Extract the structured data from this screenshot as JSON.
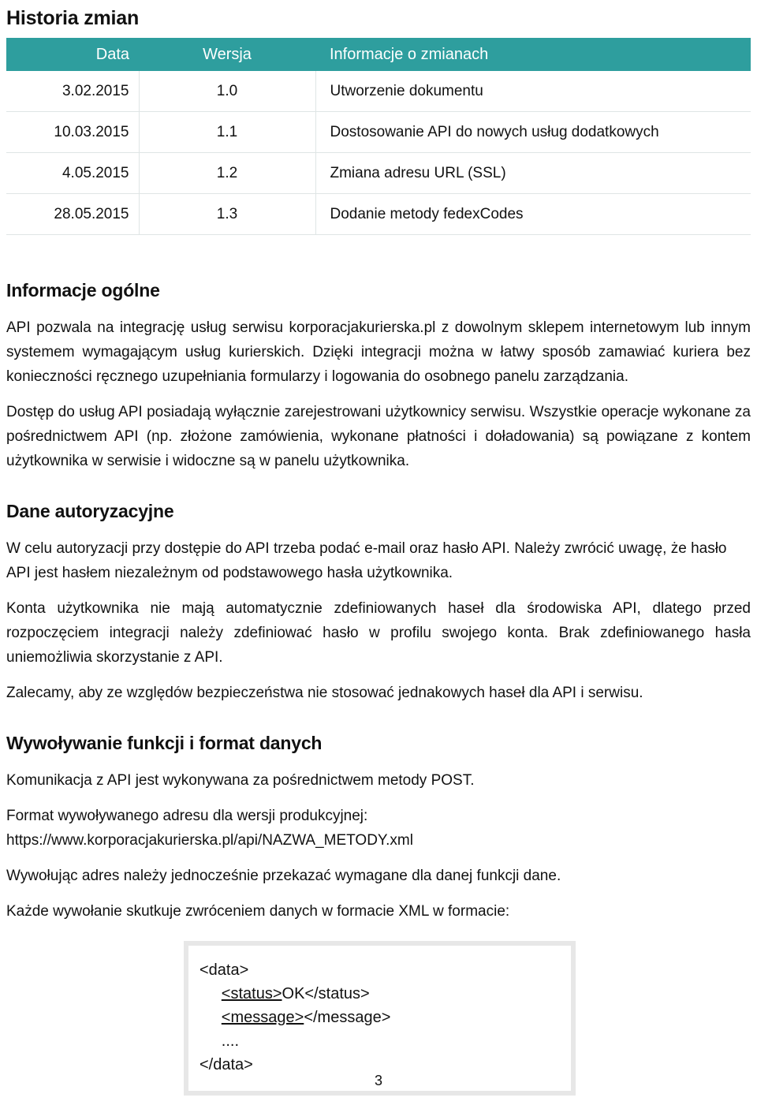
{
  "document": {
    "page_number": "3"
  },
  "history": {
    "heading": "Historia zmian",
    "columns": [
      "Data",
      "Wersja",
      "Informacje o zmianach"
    ],
    "header_bg": "#2e9e9e",
    "rows": [
      {
        "date": "3.02.2015",
        "version": "1.0",
        "info": "Utworzenie dokumentu"
      },
      {
        "date": "10.03.2015",
        "version": "1.1",
        "info": "Dostosowanie API do nowych usług dodatkowych"
      },
      {
        "date": "4.05.2015",
        "version": "1.2",
        "info": "Zmiana adresu URL (SSL)"
      },
      {
        "date": "28.05.2015",
        "version": "1.3",
        "info": "Dodanie metody fedexCodes"
      }
    ]
  },
  "general": {
    "heading": "Informacje ogólne",
    "paragraphs": [
      "API pozwala na integrację usług serwisu korporacjakurierska.pl z dowolnym sklepem internetowym lub innym systemem wymagającym usług kurierskich. Dzięki integracji można w łatwy sposób zamawiać kuriera bez konieczności ręcznego uzupełniania formularzy i logowania do osobnego panelu zarządzania.",
      "Dostęp do usług API posiadają wyłącznie zarejestrowani użytkownicy serwisu. Wszystkie operacje wykonane za pośrednictwem API (np. złożone zamówienia, wykonane płatności i doładowania) są powiązane z kontem użytkownika w serwisie i widoczne są w panelu użytkownika."
    ]
  },
  "auth": {
    "heading": "Dane autoryzacyjne",
    "paragraphs": [
      "W celu autoryzacji przy dostępie do API trzeba podać e-mail oraz hasło API. Należy zwrócić uwagę, że hasło API jest hasłem niezależnym od podstawowego hasła użytkownika.",
      "Konta użytkownika nie mają automatycznie zdefiniowanych haseł dla środowiska API, dlatego przed rozpoczęciem integracji należy zdefiniować hasło w profilu swojego konta. Brak zdefiniowanego hasła uniemożliwia skorzystanie z API.",
      "Zalecamy, aby ze względów bezpieczeństwa nie stosować jednakowych haseł dla API i serwisu."
    ]
  },
  "calling": {
    "heading": "Wywoływanie funkcji i format danych",
    "paragraphs": [
      "Komunikacja z API jest wykonywana za pośrednictwem metody POST.",
      "Format wywoływanego adresu dla wersji produkcyjnej:",
      "https://www.korporacjakurierska.pl/api/NAZWA_METODY.xml",
      "Wywołując adres należy jednocześnie przekazać wymagane dla danej funkcji dane.",
      "Każde wywołanie skutkuje zwróceniem danych w formacie XML w formacie:"
    ],
    "code_block": {
      "line1": "<data>",
      "line2_open": "<status>",
      "line2_value": "OK",
      "line2_close": "</status>",
      "line3_open": "<message>",
      "line3_close": "</message>",
      "line4": "....",
      "line5": "</data>"
    }
  }
}
